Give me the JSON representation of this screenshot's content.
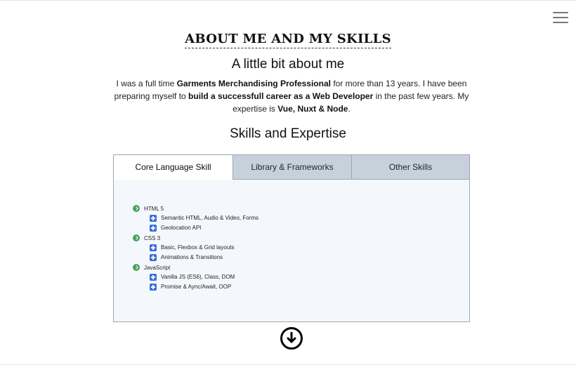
{
  "header": {
    "menu_icon": "hamburger-menu-icon"
  },
  "about": {
    "section_title": "ABOUT ME AND MY SKILLS",
    "subtitle": "A little bit about me",
    "text_part_1": "I was a full time ",
    "text_bold_1": "Garments Merchandising Professional",
    "text_part_2": " for more than 13 years. I have been preparing myself to ",
    "text_bold_2": "build a successfull career as a Web Developer",
    "text_part_3": " in the past few years. My expertise is ",
    "text_bold_3": "Vue, Nuxt & Node",
    "text_part_4": "."
  },
  "skills": {
    "title": "Skills and Expertise",
    "tabs": [
      {
        "label": "Core Language Skill",
        "active": true
      },
      {
        "label": "Library & Frameworks",
        "active": false
      },
      {
        "label": "Other Skills",
        "active": false
      }
    ],
    "groups": [
      {
        "title": "HTML 5",
        "items": [
          "Semantic HTML, Audio & Video, Forms",
          "Geolocation API"
        ]
      },
      {
        "title": "CSS 3",
        "items": [
          "Basic, Flexbox & Grid layouts",
          "Animations & Transitions"
        ]
      },
      {
        "title": "JavaScript",
        "items": [
          "Vanilla JS (ES6), Class, DOM",
          "Promise & Aync/Await, OOP"
        ]
      }
    ]
  },
  "footer": {
    "scroll_icon": "arrow-down-circle-icon"
  },
  "colors": {
    "tab_inactive_bg": "#c7d1db",
    "panel_bg": "#f4f8fc",
    "group_icon": "#49a35a",
    "item_icon": "#3a6fd8"
  }
}
